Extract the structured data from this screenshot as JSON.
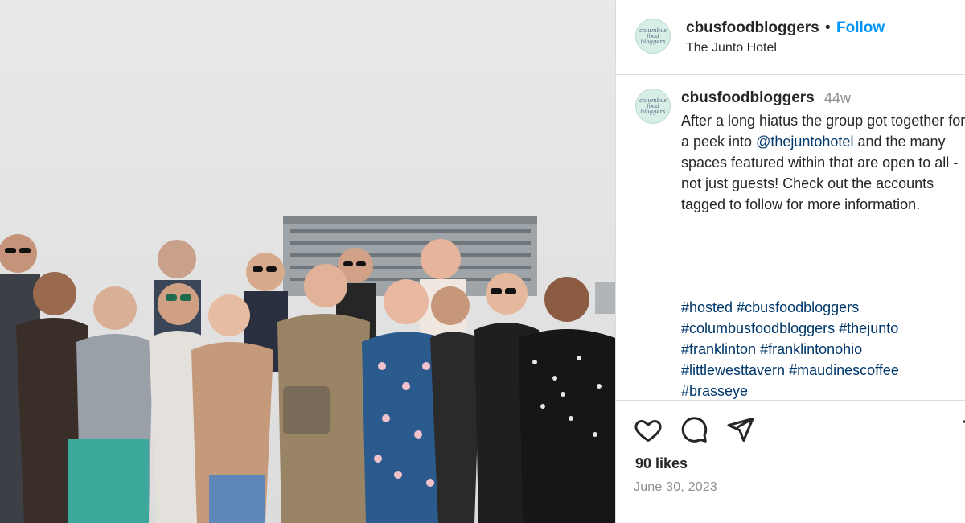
{
  "post": {
    "photo_alt": "Group of people posing on a rooftop"
  },
  "header": {
    "avatar_text": "columbus food bloggers",
    "username": "cbusfoodbloggers",
    "dot": "•",
    "follow_label": "Follow",
    "location": "The Junto Hotel"
  },
  "caption": {
    "username": "cbusfoodbloggers",
    "time": "44w",
    "text_before": "After a long hiatus the group got together for a peek into ",
    "mention": "@thejuntohotel",
    "text_after": " and the many spaces featured within that are open to all - not just guests! Check out the accounts tagged to follow for more information.",
    "hashtags": [
      "#hosted",
      "#cbusfoodbloggers",
      "#columbusfoodbloggers",
      "#thejunto",
      "#franklinton",
      "#franklintonohio",
      "#littlewesttavern",
      "#maudinescoffee",
      "#brasseye"
    ]
  },
  "actions": {
    "like_icon": "heart-icon",
    "comment_icon": "comment-icon",
    "share_icon": "share-icon",
    "save_icon": "bookmark-icon"
  },
  "likes": "90 likes",
  "date": "June 30, 2023",
  "colors": {
    "link": "#00376b",
    "follow": "#0095f6",
    "muted": "#8e8e8e"
  }
}
